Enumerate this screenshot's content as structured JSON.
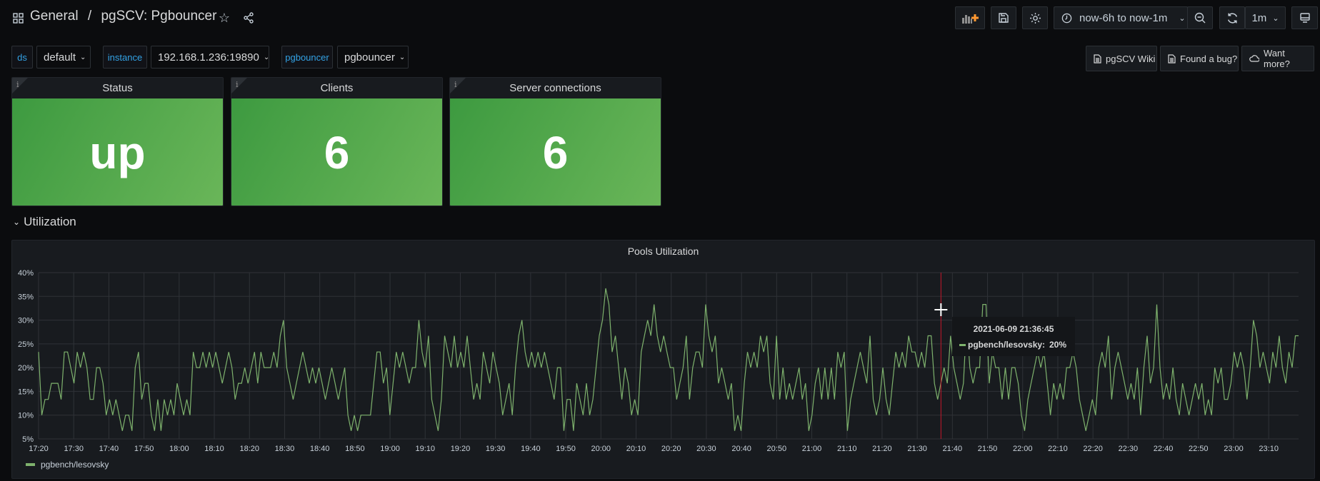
{
  "header": {
    "folder": "General",
    "separator": "/",
    "dashboard": "pgSCV: Pgbouncer"
  },
  "toolbar": {
    "time_range": "now-6h to now-1m",
    "refresh_interval": "1m"
  },
  "variables": [
    {
      "label": "ds",
      "value": "default"
    },
    {
      "label": "instance",
      "value": "192.168.1.236:19890"
    },
    {
      "label": "pgbouncer",
      "value": "pgbouncer"
    }
  ],
  "links": [
    "pgSCV Wiki",
    "Found a bug?",
    "Want more?"
  ],
  "stats": [
    {
      "title": "Status",
      "value": "up",
      "info": "i"
    },
    {
      "title": "Clients",
      "value": "6",
      "info": "i"
    },
    {
      "title": "Server connections",
      "value": "6",
      "info": "i"
    }
  ],
  "row": {
    "title": "Utilization"
  },
  "colors": {
    "stat_green": "#56a64b",
    "series": "#7eb26d",
    "cursor": "#c4162a",
    "link_blue": "#33a2e5"
  },
  "tooltip": {
    "time": "2021-06-09 21:36:45",
    "series": "pgbench/lesovsky:",
    "value": "20%"
  },
  "chart_data": {
    "type": "line",
    "title": "Pools Utilization",
    "xlabel": "",
    "ylabel": "",
    "ylim": [
      5,
      40
    ],
    "yticks": [
      "5%",
      "10%",
      "15%",
      "20%",
      "25%",
      "30%",
      "35%",
      "40%"
    ],
    "xlim_minutes_from_17_20": [
      0,
      358.5
    ],
    "xticks": [
      "17:20",
      "17:30",
      "17:40",
      "17:50",
      "18:00",
      "18:10",
      "18:20",
      "18:30",
      "18:40",
      "18:50",
      "19:00",
      "19:10",
      "19:20",
      "19:30",
      "19:40",
      "19:50",
      "20:00",
      "20:10",
      "20:20",
      "20:30",
      "20:40",
      "20:50",
      "21:00",
      "21:10",
      "21:20",
      "21:30",
      "21:40",
      "21:50",
      "22:00",
      "22:10",
      "22:20",
      "22:30",
      "22:40",
      "22:50",
      "23:00",
      "23:10"
    ],
    "grid": true,
    "legend": "bottom-left",
    "cursor_time_minutes_from_17_20": 256.75,
    "series": [
      {
        "name": "pgbench/lesovsky",
        "unit": "%",
        "values_sixtieths_note": "values are percent",
        "values": [
          23.3,
          10,
          13.3,
          13.3,
          16.7,
          16.7,
          16.7,
          13.3,
          23.3,
          23.3,
          20,
          16.7,
          23.3,
          20,
          23.3,
          20,
          13.3,
          13.3,
          20,
          20,
          16.7,
          10,
          13.3,
          10,
          13.3,
          10,
          6.7,
          10,
          10,
          6.7,
          20,
          23.3,
          13.3,
          16.7,
          16.7,
          10,
          6.7,
          13.3,
          6.7,
          13.3,
          10,
          13.3,
          10,
          16.7,
          13.3,
          10,
          13.3,
          10,
          23.3,
          20,
          20,
          23.3,
          20,
          23.3,
          20,
          23.3,
          20,
          16.7,
          20,
          23.3,
          20,
          13.3,
          16.7,
          16.7,
          20,
          16.7,
          20,
          23.3,
          16.7,
          23.3,
          20,
          20,
          20,
          23.3,
          20,
          26.7,
          30,
          20,
          16.7,
          13.3,
          16.7,
          20,
          23.3,
          20,
          16.7,
          20,
          16.7,
          20,
          16.7,
          13.3,
          16.7,
          20,
          16.7,
          13.3,
          16.7,
          20,
          10,
          6.7,
          10,
          6.7,
          10,
          10,
          10,
          10,
          16.7,
          23.3,
          23.3,
          16.7,
          20,
          10,
          16.7,
          23.3,
          20,
          23.3,
          20,
          16.7,
          20,
          20,
          30,
          23.3,
          20,
          26.7,
          13.3,
          10,
          6.7,
          13.3,
          26.7,
          23.3,
          20,
          26.7,
          20,
          23.3,
          20,
          26.7,
          20,
          13.3,
          16.7,
          13.3,
          23.3,
          20,
          16.7,
          23.3,
          20,
          16.7,
          10,
          13.3,
          16.7,
          10,
          20,
          26.7,
          30,
          23.3,
          20,
          23.3,
          20,
          23.3,
          20,
          23.3,
          20,
          16.7,
          13.3,
          20,
          20,
          6.7,
          13.3,
          13.3,
          6.7,
          16.7,
          13.3,
          10,
          16.7,
          10,
          13.3,
          20,
          26.7,
          30,
          36.7,
          33.3,
          23.3,
          26.7,
          20,
          13.3,
          20,
          16.7,
          10,
          13.3,
          10,
          23.3,
          26.7,
          30,
          26.7,
          33.3,
          26.7,
          23.3,
          26.7,
          23.3,
          20,
          20,
          13.3,
          16.7,
          20,
          26.7,
          13.3,
          20,
          23.3,
          23.3,
          20,
          33.3,
          26.7,
          23.3,
          26.7,
          16.7,
          20,
          16.7,
          13.3,
          16.7,
          6.7,
          10,
          6.7,
          16.7,
          23.3,
          20,
          23.3,
          20,
          26.7,
          23.3,
          26.7,
          16.7,
          13.3,
          26.7,
          13.3,
          20,
          13.3,
          16.7,
          13.3,
          16.7,
          20,
          13.3,
          16.7,
          6.7,
          10,
          16.7,
          20,
          13.3,
          20,
          13.3,
          20,
          13.3,
          23.3,
          20,
          23.3,
          6.7,
          13.3,
          16.7,
          20,
          23.3,
          20,
          16.7,
          26.7,
          13.3,
          10,
          13.3,
          20,
          13.3,
          10,
          16.7,
          23.3,
          20,
          23.3,
          20,
          26.7,
          23.3,
          23.3,
          20,
          23.3,
          20,
          26.7,
          26.7,
          16.7,
          13.3,
          16.7,
          20,
          16.7,
          26.7,
          20,
          16.7,
          13.3,
          16.7,
          30,
          20,
          16.7,
          20,
          20,
          33.3,
          33.3,
          16.7,
          23.3,
          20,
          20,
          13.3,
          20,
          13.3,
          20,
          20,
          16.7,
          10,
          6.7,
          13.3,
          16.7,
          20,
          23.3,
          20,
          23.3,
          16.7,
          10,
          16.7,
          13.3,
          16.7,
          13.3,
          20,
          20,
          23.3,
          20,
          13.3,
          10,
          6.7,
          10,
          13.3,
          10,
          20,
          23.3,
          20,
          26.7,
          13.3,
          20,
          23.3,
          20,
          16.7,
          13.3,
          16.7,
          13.3,
          20,
          10,
          20,
          26.7,
          16.7,
          20,
          33.3,
          20,
          13.3,
          16.7,
          13.3,
          20,
          13.3,
          10,
          16.7,
          13.3,
          10,
          13.3,
          16.7,
          13.3,
          16.7,
          10,
          13.3,
          10,
          20,
          16.7,
          20,
          13.3,
          13.3,
          16.7,
          23.3,
          20,
          23.3,
          20,
          13.3,
          20,
          30,
          26.7,
          20,
          23.3,
          20,
          16.7,
          23.3,
          20,
          26.7,
          20,
          16.7,
          23.3,
          20,
          26.7,
          26.7
        ]
      }
    ]
  }
}
